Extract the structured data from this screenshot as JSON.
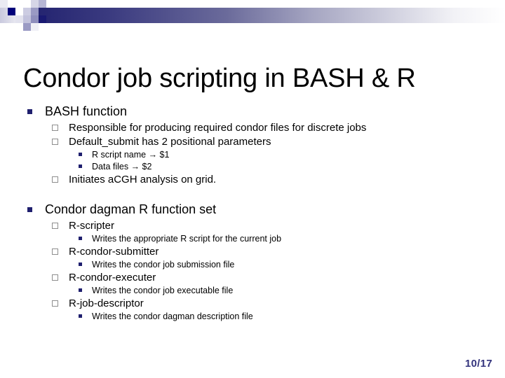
{
  "header": {
    "gradient_start": "#17176b",
    "gradient_end": "#ffffff",
    "mosaic_dark": "#00007a",
    "mosaic_mid": "#9a9ac4",
    "mosaic_light": "#c9c9e2",
    "mosaic_pale": "#e6e6f0"
  },
  "title": "Condor job scripting in BASH & R",
  "outline": [
    {
      "level": 1,
      "text": "BASH function",
      "bullet": "filled-square-bullet"
    },
    {
      "level": 2,
      "text": "Responsible for producing required condor files for discrete jobs",
      "bullet": "hollow-square-bullet"
    },
    {
      "level": 2,
      "text": "Default_submit has 2 positional parameters",
      "bullet": "hollow-square-bullet"
    },
    {
      "level": 3,
      "text": "R script name → $1",
      "bullet": "small-filled-square-bullet"
    },
    {
      "level": 3,
      "text": "Data files → $2",
      "bullet": "small-filled-square-bullet"
    },
    {
      "level": 2,
      "text": "Initiates aCGH analysis on grid.",
      "bullet": "hollow-square-bullet"
    },
    {
      "level": 1,
      "text": "Condor dagman R function set",
      "bullet": "filled-square-bullet",
      "gap_before": true
    },
    {
      "level": 2,
      "text": "R-scripter",
      "bullet": "hollow-square-bullet"
    },
    {
      "level": 3,
      "text": "Writes the appropriate R script for the current job",
      "bullet": "small-filled-square-bullet"
    },
    {
      "level": 2,
      "text": "R-condor-submitter",
      "bullet": "hollow-square-bullet"
    },
    {
      "level": 3,
      "text": "Writes the condor job submission file",
      "bullet": "small-filled-square-bullet"
    },
    {
      "level": 2,
      "text": "R-condor-executer",
      "bullet": "hollow-square-bullet"
    },
    {
      "level": 3,
      "text": "Writes the condor job executable file",
      "bullet": "small-filled-square-bullet"
    },
    {
      "level": 2,
      "text": "R-job-descriptor",
      "bullet": "hollow-square-bullet"
    },
    {
      "level": 3,
      "text": "Writes the condor dagman description file",
      "bullet": "small-filled-square-bullet"
    }
  ],
  "page_number": "10/17",
  "page_number_color": "#34347d"
}
